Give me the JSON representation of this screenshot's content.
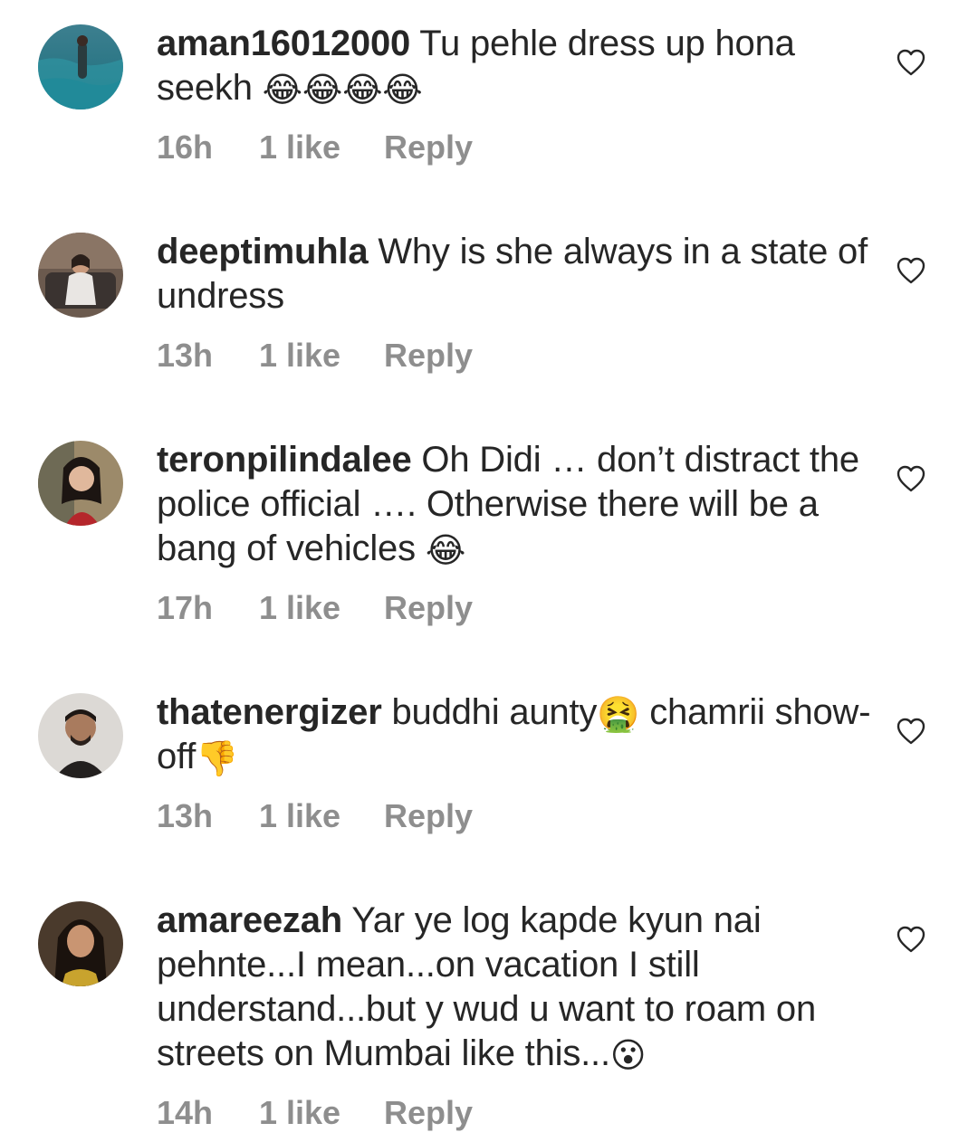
{
  "comments": [
    {
      "username": "aman16012000",
      "text": "Tu pehle dress up hona seekh",
      "emoji": "😂😂😂😂",
      "time": "16h",
      "likes": "1 like",
      "reply": "Reply",
      "avatar_icon": "ocean-photo"
    },
    {
      "username": "deeptimuhla",
      "text": "Why is she always in a state of undress",
      "emoji": "",
      "time": "13h",
      "likes": "1 like",
      "reply": "Reply",
      "avatar_icon": "woman-on-sofa-photo"
    },
    {
      "username": "teronpilindalee",
      "text": "Oh Didi … don’t distract the police official …. Otherwise there will be a bang of vehicles",
      "emoji": "😂",
      "time": "17h",
      "likes": "1 like",
      "reply": "Reply",
      "avatar_icon": "woman-portrait-photo"
    },
    {
      "username": "thatenergizer",
      "text": "buddhi aunty",
      "emoji": "🤮",
      "text2": " chamrii show-off",
      "emoji2": "👎",
      "time": "13h",
      "likes": "1 like",
      "reply": "Reply",
      "avatar_icon": "man-portrait-photo"
    },
    {
      "username": "amareezah",
      "text": "Yar ye log kapde kyun nai pehnte...I mean...on vacation I still understand...but y wud u want to roam on streets on Mumbai like this...",
      "emoji": "😮",
      "time": "14h",
      "likes": "1 like",
      "reply": "Reply",
      "avatar_icon": "woman-portrait-photo"
    }
  ],
  "colors": {
    "text": "#262626",
    "meta": "#8e8e8e",
    "heart": "#262626"
  }
}
